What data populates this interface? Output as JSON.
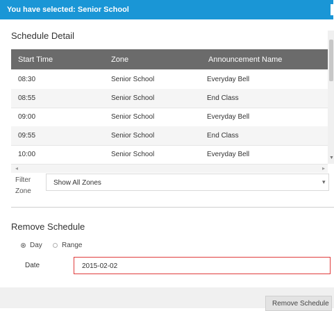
{
  "banner": {
    "text": "You have selected: Senior School",
    "color": "#1a96d6"
  },
  "schedule": {
    "title": "Schedule Detail",
    "columns": [
      "Start Time",
      "Zone",
      "Announcement Name"
    ],
    "rows": [
      {
        "start": "08:30",
        "zone": "Senior School",
        "announcement": "Everyday Bell"
      },
      {
        "start": "08:55",
        "zone": "Senior School",
        "announcement": "End Class"
      },
      {
        "start": "09:00",
        "zone": "Senior School",
        "announcement": "Everyday Bell"
      },
      {
        "start": "09:55",
        "zone": "Senior School",
        "announcement": "End Class"
      },
      {
        "start": "10:00",
        "zone": "Senior School",
        "announcement": "Everyday Bell"
      }
    ]
  },
  "filter": {
    "label": "Filter Zone",
    "value": "Show All Zones"
  },
  "remove": {
    "title": "Remove Schedule",
    "options": [
      {
        "label": "Day",
        "checked": true
      },
      {
        "label": "Range",
        "checked": false
      }
    ],
    "date_label": "Date",
    "date_value": "2015-02-02",
    "button_label": "Remove Schedule"
  },
  "icons": {
    "scroll_left": "arrow-left-icon",
    "scroll_right": "arrow-right-icon",
    "scroll_down": "arrow-down-icon",
    "select_caret": "caret-down-icon"
  }
}
